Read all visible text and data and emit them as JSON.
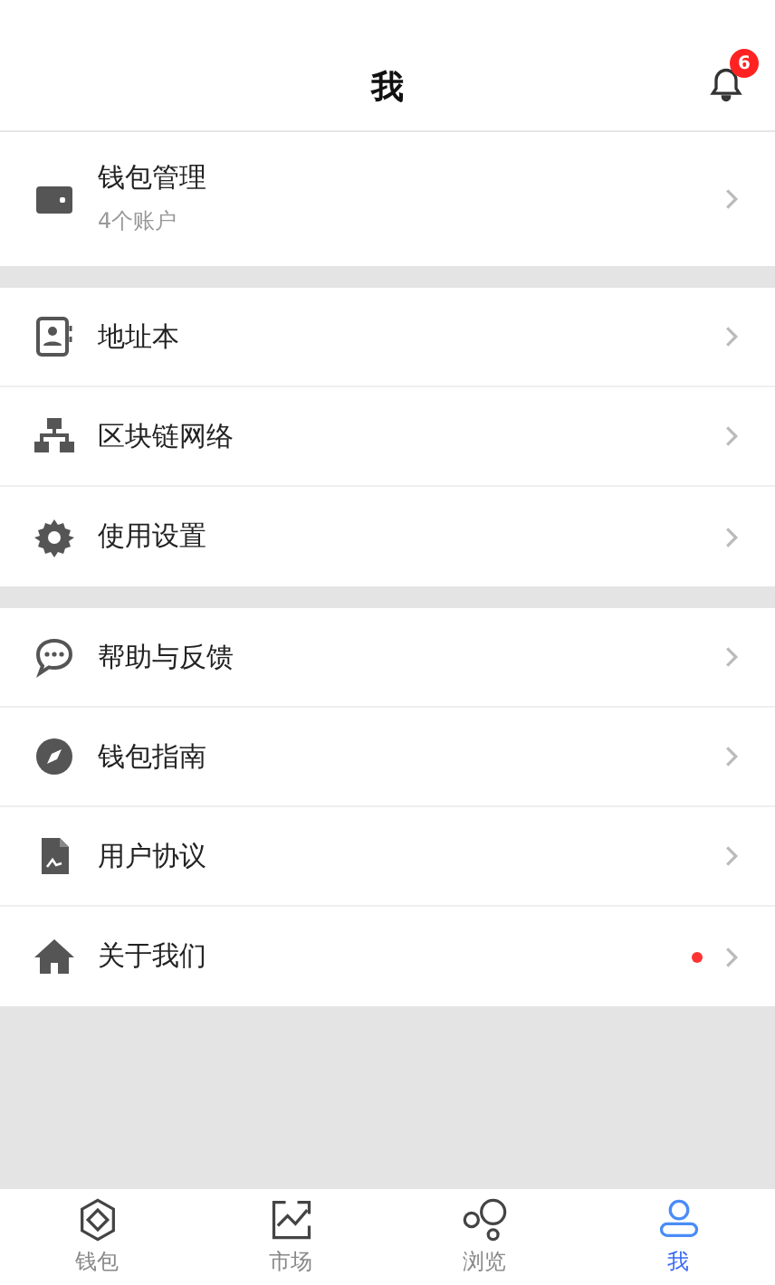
{
  "header": {
    "title": "我",
    "notification_badge": "6"
  },
  "sections": [
    {
      "items": [
        {
          "label": "钱包管理",
          "subtitle": "4个账户",
          "dot": false
        }
      ]
    },
    {
      "items": [
        {
          "label": "地址本",
          "dot": false
        },
        {
          "label": "区块链网络",
          "dot": false
        },
        {
          "label": "使用设置",
          "dot": false
        }
      ]
    },
    {
      "items": [
        {
          "label": "帮助与反馈",
          "dot": false
        },
        {
          "label": "钱包指南",
          "dot": false
        },
        {
          "label": "用户协议",
          "dot": false
        },
        {
          "label": "关于我们",
          "dot": true
        }
      ]
    }
  ],
  "tabs": [
    {
      "label": "钱包",
      "selected": false
    },
    {
      "label": "市场",
      "selected": false
    },
    {
      "label": "浏览",
      "selected": false
    },
    {
      "label": "我",
      "selected": true
    }
  ]
}
